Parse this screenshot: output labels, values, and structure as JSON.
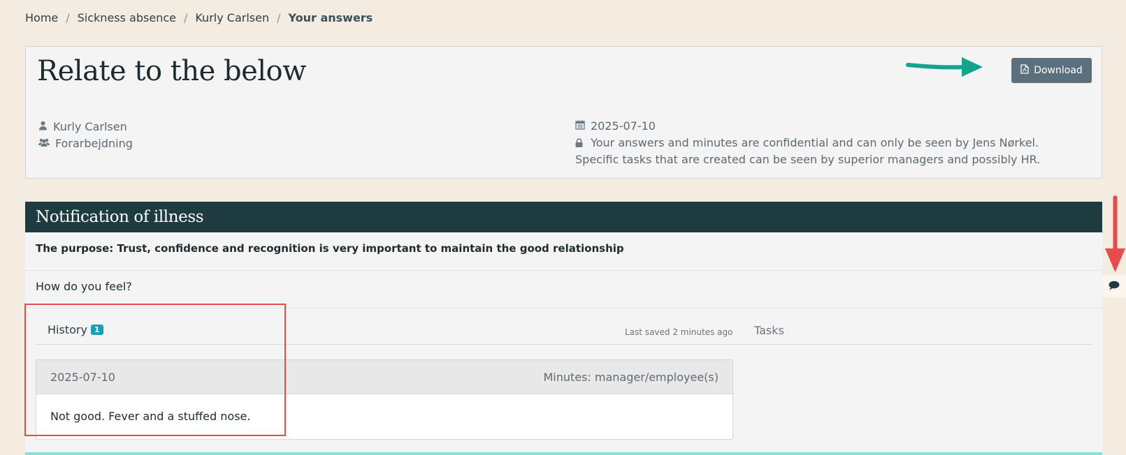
{
  "breadcrumb": {
    "items": [
      "Home",
      "Sickness absence",
      "Kurly Carlsen"
    ],
    "current": "Your answers",
    "separator": "/"
  },
  "header": {
    "title": "Relate to the below",
    "download_label": "Download",
    "user_name": "Kurly Carlsen",
    "group": "Forarbejdning",
    "date": "2025-07-10",
    "confidential_note": "Your answers and minutes are confidential and can only be seen by Jens Nørkel. Specific tasks that are created can be seen by superior managers and possibly HR."
  },
  "section": {
    "title": "Notification of illness",
    "purpose": "The purpose: Trust, confidence and recognition is very important to maintain the good relationship",
    "question": "How do you feel?"
  },
  "history": {
    "tab_label": "History",
    "count": "1",
    "last_saved": "Last saved 2 minutes ago",
    "entries": [
      {
        "date": "2025-07-10",
        "type": "Minutes: manager/employee(s)",
        "text": "Not good. Fever and a stuffed nose."
      }
    ]
  },
  "tasks": {
    "tab_label": "Tasks"
  },
  "colors": {
    "page_bg": "#f5ece1",
    "section_header": "#1e3c3f",
    "download_button": "#5c6f7c",
    "badge": "#1b9fb3",
    "annotation_green": "#13a58b",
    "annotation_red": "#e84b4b"
  },
  "icons": {
    "user": "user-icon",
    "group": "users-icon",
    "date": "calendar-icon",
    "lock": "lock-icon",
    "download": "pdf-file-icon",
    "chat": "comment-icon"
  }
}
